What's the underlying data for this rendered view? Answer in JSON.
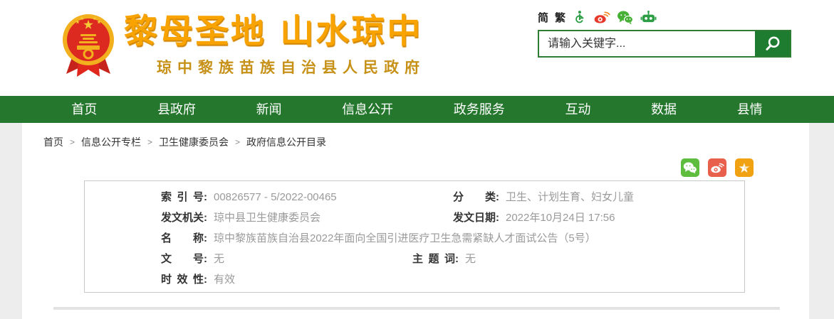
{
  "colors": {
    "nav_green": "#26772e",
    "search_button_green": "#1e7c30",
    "search_border_green": "#2e7d33",
    "slogan_gold": "#f8a300",
    "site_name_gold": "#c79118",
    "emblem_red": "#dd2a21",
    "emblem_gold": "#f2b01f",
    "wechat_green": "#5ebd3e",
    "weibo_red": "#e8604c",
    "star_orange": "#f0a213",
    "value_gray": "#9a9a9a",
    "page_side_gray": "#ededed"
  },
  "topbar": {
    "lang": {
      "simplified": "简",
      "traditional": "繁"
    },
    "icons": [
      "accessibility-icon",
      "weibo-icon",
      "wechat-icon",
      "robot-icon"
    ]
  },
  "header": {
    "slogan": "黎母圣地 山水琼中",
    "site_name": "琼中黎族苗族自治县人民政府",
    "emblem": "china-national-emblem",
    "search": {
      "placeholder": "请输入关键字...",
      "button_icon": "search-icon"
    }
  },
  "nav": {
    "items": [
      {
        "label": "首页"
      },
      {
        "label": "县政府"
      },
      {
        "label": "新闻"
      },
      {
        "label": "信息公开"
      },
      {
        "label": "政务服务"
      },
      {
        "label": "互动"
      },
      {
        "label": "数据"
      },
      {
        "label": "县情"
      }
    ]
  },
  "breadcrumb": {
    "separator": ">",
    "items": [
      {
        "label": "首页"
      },
      {
        "label": "信息公开专栏"
      },
      {
        "label": "卫生健康委员会"
      },
      {
        "label": "政府信息公开目录"
      }
    ]
  },
  "share": {
    "icons": [
      "wechat-share-icon",
      "weibo-share-icon",
      "favorite-star-icon"
    ]
  },
  "doc_info": {
    "colon": ":",
    "fields": {
      "index_no": {
        "label": "索引号",
        "value": "00826577 - 5/2022-00465"
      },
      "category": {
        "label": "分类",
        "value": "卫生、计划生育、妇女儿童"
      },
      "issuing_org": {
        "label": "发文机关",
        "value": "琼中县卫生健康委员会"
      },
      "issue_date": {
        "label": "发文日期",
        "value": "2022年10月24日 17:56"
      },
      "title": {
        "label": "名称",
        "value": "琼中黎族苗族自治县2022年面向全国引进医疗卫生急需紧缺人才面试公告（5号）"
      },
      "doc_no": {
        "label": "文号",
        "value": "无"
      },
      "keywords": {
        "label": "主题词",
        "value": "无"
      },
      "validity": {
        "label": "时效性",
        "value": "有效"
      }
    }
  }
}
